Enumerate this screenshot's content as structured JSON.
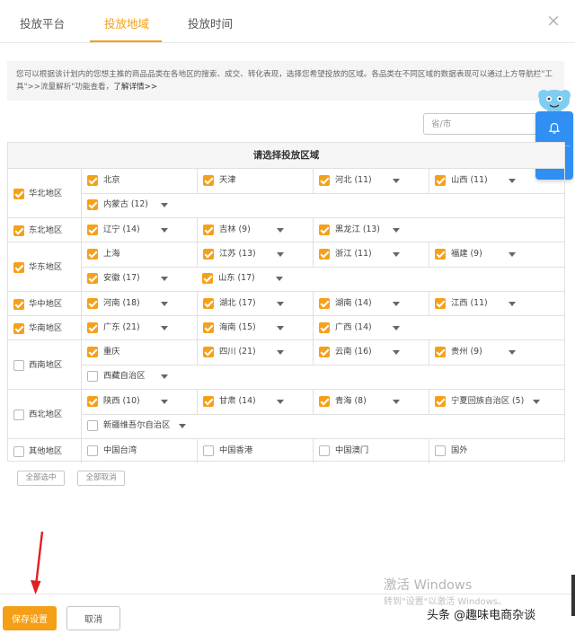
{
  "tabs": [
    "投放平台",
    "投放地域",
    "投放时间"
  ],
  "active_tab": 1,
  "close_icon": "close-icon",
  "info": {
    "text": "您可以根据该计划内的您想主推的商品品类在各地区的搜索、成交、转化表现，选择您希望投放的区域。各品类在不同区域的数据表现可以通过上方导航栏\"工具\">>流量解析\"功能查看，",
    "link": "了解详情>>"
  },
  "search": {
    "placeholder": "省/市"
  },
  "float_panel": {
    "icons": [
      "bell-icon",
      "chat-icon"
    ],
    "color": "#2f8ff3"
  },
  "table": {
    "title": "请选择投放区域",
    "regions": [
      {
        "name": "华北地区",
        "checked": true,
        "provinces": [
          {
            "label": "北京",
            "checked": true,
            "dropdown": false
          },
          {
            "label": "天津",
            "checked": true,
            "dropdown": false
          },
          {
            "label": "河北 (11)",
            "checked": true,
            "dropdown": true
          },
          {
            "label": "山西 (11)",
            "checked": true,
            "dropdown": true
          },
          {
            "label": "内蒙古 (12)",
            "checked": true,
            "dropdown": true
          }
        ]
      },
      {
        "name": "东北地区",
        "checked": true,
        "provinces": [
          {
            "label": "辽宁 (14)",
            "checked": true,
            "dropdown": true
          },
          {
            "label": "吉林 (9)",
            "checked": true,
            "dropdown": true
          },
          {
            "label": "黑龙江 (13)",
            "checked": true,
            "dropdown": true
          }
        ]
      },
      {
        "name": "华东地区",
        "checked": true,
        "provinces": [
          {
            "label": "上海",
            "checked": true,
            "dropdown": false
          },
          {
            "label": "江苏 (13)",
            "checked": true,
            "dropdown": true
          },
          {
            "label": "浙江 (11)",
            "checked": true,
            "dropdown": true
          },
          {
            "label": "福建 (9)",
            "checked": true,
            "dropdown": true
          },
          {
            "label": "安徽 (17)",
            "checked": true,
            "dropdown": true
          },
          {
            "label": "山东 (17)",
            "checked": true,
            "dropdown": true
          }
        ]
      },
      {
        "name": "华中地区",
        "checked": true,
        "provinces": [
          {
            "label": "河南 (18)",
            "checked": true,
            "dropdown": true
          },
          {
            "label": "湖北 (17)",
            "checked": true,
            "dropdown": true
          },
          {
            "label": "湖南 (14)",
            "checked": true,
            "dropdown": true
          },
          {
            "label": "江西 (11)",
            "checked": true,
            "dropdown": true
          }
        ]
      },
      {
        "name": "华南地区",
        "checked": true,
        "provinces": [
          {
            "label": "广东 (21)",
            "checked": true,
            "dropdown": true
          },
          {
            "label": "海南 (15)",
            "checked": true,
            "dropdown": true
          },
          {
            "label": "广西 (14)",
            "checked": true,
            "dropdown": true
          }
        ]
      },
      {
        "name": "西南地区",
        "checked": false,
        "provinces": [
          {
            "label": "重庆",
            "checked": true,
            "dropdown": false
          },
          {
            "label": "四川 (21)",
            "checked": true,
            "dropdown": true
          },
          {
            "label": "云南 (16)",
            "checked": true,
            "dropdown": true
          },
          {
            "label": "贵州 (9)",
            "checked": true,
            "dropdown": true
          },
          {
            "label": "西藏自治区",
            "checked": false,
            "dropdown": true
          }
        ]
      },
      {
        "name": "西北地区",
        "checked": false,
        "provinces": [
          {
            "label": "陕西 (10)",
            "checked": true,
            "dropdown": true
          },
          {
            "label": "甘肃 (14)",
            "checked": true,
            "dropdown": true
          },
          {
            "label": "青海 (8)",
            "checked": true,
            "dropdown": true
          },
          {
            "label": "宁夏回族自治区 (5)",
            "checked": true,
            "dropdown": true
          },
          {
            "label": "新疆维吾尔自治区",
            "checked": false,
            "dropdown": true
          }
        ]
      },
      {
        "name": "其他地区",
        "checked": false,
        "provinces": [
          {
            "label": "中国台湾",
            "checked": false,
            "dropdown": false
          },
          {
            "label": "中国香港",
            "checked": false,
            "dropdown": false
          },
          {
            "label": "中国澳门",
            "checked": false,
            "dropdown": false
          },
          {
            "label": "国外",
            "checked": false,
            "dropdown": false
          }
        ]
      }
    ]
  },
  "select_all_label": "全部选中",
  "deselect_all_label": "全部取消",
  "save_label": "保存设置",
  "cancel_label": "取消",
  "watermark": {
    "title": "激活 Windows",
    "subtitle": "转到\"设置\"以激活 Windows。"
  },
  "credit": "头条 @趣味电商杂谈",
  "colors": {
    "accent": "#f49f16",
    "panel_blue": "#2f8ff3",
    "annotation_red": "#e02020"
  }
}
